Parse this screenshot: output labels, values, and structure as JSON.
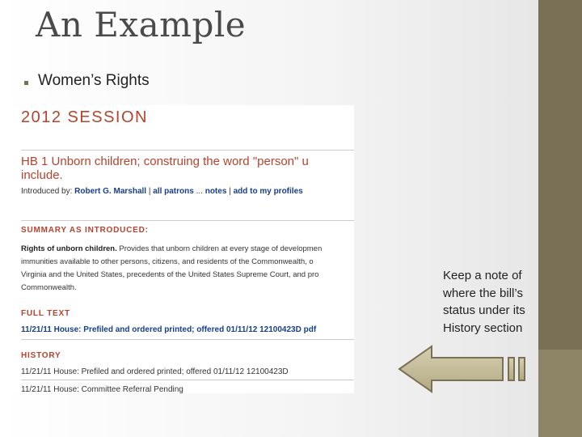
{
  "slide": {
    "title": "An Example",
    "bullets": [
      "Women’s Rights"
    ]
  },
  "document": {
    "session": "2012 SESSION",
    "bill_title_line1": "HB 1 Unborn children; construing the word \"person\" u",
    "bill_title_line2": "include.",
    "introduced_label": "Introduced by:",
    "introduced_by": "Robert G. Marshall",
    "all_patrons": "all patrons",
    "ellipsis": "...",
    "notes": "notes",
    "add_to_profiles": "add to my profiles",
    "summary_heading": "SUMMARY AS INTRODUCED:",
    "summary_bold": "Rights of unborn children.",
    "summary_line1": " Provides that unborn children at every stage of developmen",
    "summary_line2": "immunities available to other persons, citizens, and residents of the Commonwealth, o",
    "summary_line3": "Virginia and the United States, precedents of the United States Supreme Court, and pro",
    "summary_line4": "Commonwealth.",
    "full_text_heading": "FULL TEXT",
    "full_text_link": "11/21/11  House: Prefiled and ordered printed; offered 01/11/12 12100423D  pdf",
    "history_heading": "HISTORY",
    "history_items": [
      "11/21/11  House: Prefiled and ordered printed; offered 01/11/12 12100423D",
      "11/21/11  House: Committee Referral Pending"
    ]
  },
  "note": {
    "lines": [
      "Keep a note of",
      "where the bill’s",
      "status under its",
      "History section"
    ]
  },
  "colors": {
    "accent_bar": "#7a7055",
    "doc_heading": "#b5432d",
    "doc_link": "#163e8a",
    "arrow_fill": "#c6bd9a",
    "arrow_stroke": "#7a7055"
  },
  "icons": {
    "arrow": "left-arrow-icon"
  }
}
